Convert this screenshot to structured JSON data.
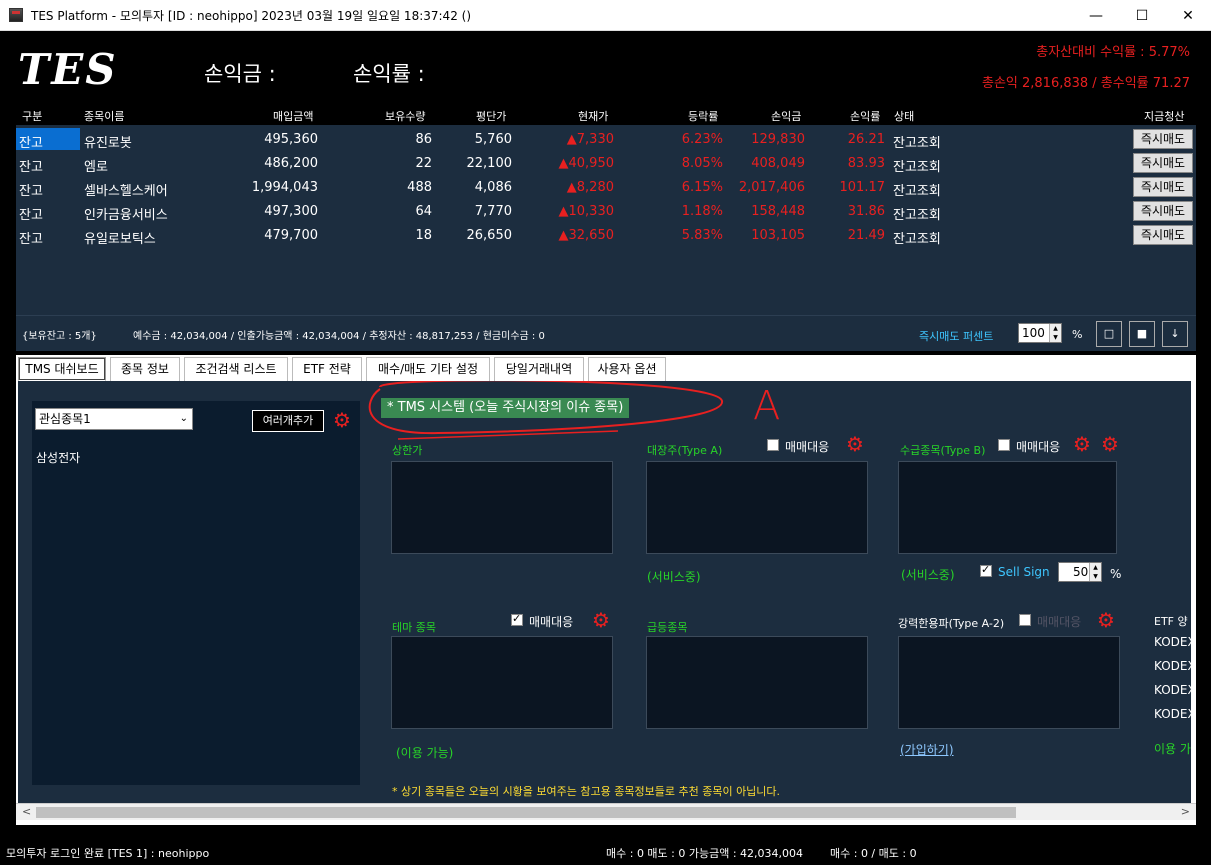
{
  "window": {
    "title": "TES Platform - 모의투자 [ID : neohippo] 2023년 03월 19일 일요일 18:37:42 ()",
    "minimize": "—",
    "maximize": "☐",
    "close": "✕"
  },
  "header": {
    "logo": "TES",
    "pl_amount_label": "손익금 :",
    "pl_rate_label": "손익률 :",
    "asset_return": "총자산대비 수익률 : 5.77%",
    "total_pl": "총손익 2,816,838 / 총수익률 71.27"
  },
  "holdings": {
    "columns": [
      "구분",
      "종목이름",
      "매입금액",
      "보유수량",
      "평단가",
      "현재가",
      "등락률",
      "손익금",
      "손익률",
      "상태",
      "지금청산"
    ],
    "rows": [
      {
        "kind": "잔고",
        "name": "유진로봇",
        "buy_amount": "495,360",
        "qty": "86",
        "avg": "5,760",
        "price": "▲7,330",
        "change": "6.23%",
        "pl": "129,830",
        "pl_rate": "26.21",
        "status": "잔고조회",
        "action": "즉시매도"
      },
      {
        "kind": "잔고",
        "name": "엠로",
        "buy_amount": "486,200",
        "qty": "22",
        "avg": "22,100",
        "price": "▲40,950",
        "change": "8.05%",
        "pl": "408,049",
        "pl_rate": "83.93",
        "status": "잔고조회",
        "action": "즉시매도"
      },
      {
        "kind": "잔고",
        "name": "셀바스헬스케어",
        "buy_amount": "1,994,043",
        "qty": "488",
        "avg": "4,086",
        "price": "▲8,280",
        "change": "6.15%",
        "pl": "2,017,406",
        "pl_rate": "101.17",
        "status": "잔고조회",
        "action": "즉시매도"
      },
      {
        "kind": "잔고",
        "name": "인카금융서비스",
        "buy_amount": "497,300",
        "qty": "64",
        "avg": "7,770",
        "price": "▲10,330",
        "change": "1.18%",
        "pl": "158,448",
        "pl_rate": "31.86",
        "status": "잔고조회",
        "action": "즉시매도"
      },
      {
        "kind": "잔고",
        "name": "유일로보틱스",
        "buy_amount": "479,700",
        "qty": "18",
        "avg": "26,650",
        "price": "▲32,650",
        "change": "5.83%",
        "pl": "103,105",
        "pl_rate": "21.49",
        "status": "잔고조회",
        "action": "즉시매도"
      }
    ]
  },
  "strip": {
    "balance_count": "{보유잔고 : 5개}",
    "deposit_info": "예수금 : 42,034,004 / 인출가능금액 : 42,034,004 / 추정자산 : 48,817,253 / 현금미수금 : 0",
    "instant_sell_pct_label": "즉시매도 퍼센트",
    "instant_sell_pct_value": "100",
    "pct_sign": "%",
    "btn1": "□",
    "btn2": "■",
    "btn3": "↓"
  },
  "tabs": [
    "TMS 대쉬보드",
    "종목 정보",
    "조건검색 리스트",
    "ETF 전략",
    "매수/매도 기타 설정",
    "당일거래내역",
    "사용자 옵션"
  ],
  "watchlist": {
    "selected": "관심종목1",
    "add_button": "여러개추가",
    "items": [
      "삼성전자"
    ]
  },
  "tms": {
    "title": "* TMS 시스템 (오늘 주식시장의 이슈 종목)",
    "annotation": "A",
    "upper_limit": "상한가",
    "large_cap": "대장주(Type A)",
    "trade_response": "매매대응",
    "supply": "수급종목(Type B)",
    "in_service": "(서비스중)",
    "sell_sign": "Sell Sign",
    "sell_sign_value": "50",
    "pct": "%",
    "theme": "테마 종목",
    "surge": "급등종목",
    "strong_shape": "강력한용파(Type A-2)",
    "available": "(이용 가능)",
    "signup": "(가입하기)",
    "etf_header": "ETF 양",
    "etf_items": [
      "KODEX",
      "KODEX",
      "KODEX",
      "KODEX"
    ],
    "etf_available": "이용 가",
    "disclaimer": "* 상기 종목들은 오늘의 시황을 보여주는 참고용 종목정보들로 추천 종목이 아닙니다."
  },
  "statusbar": {
    "login": "모의투자 로그인 완료 [TES 1] : neohippo",
    "orders": "매수 : 0 매도 : 0 가능금액 : 42,034,004",
    "ratio": "매수 : 0 / 매도 : 0"
  }
}
